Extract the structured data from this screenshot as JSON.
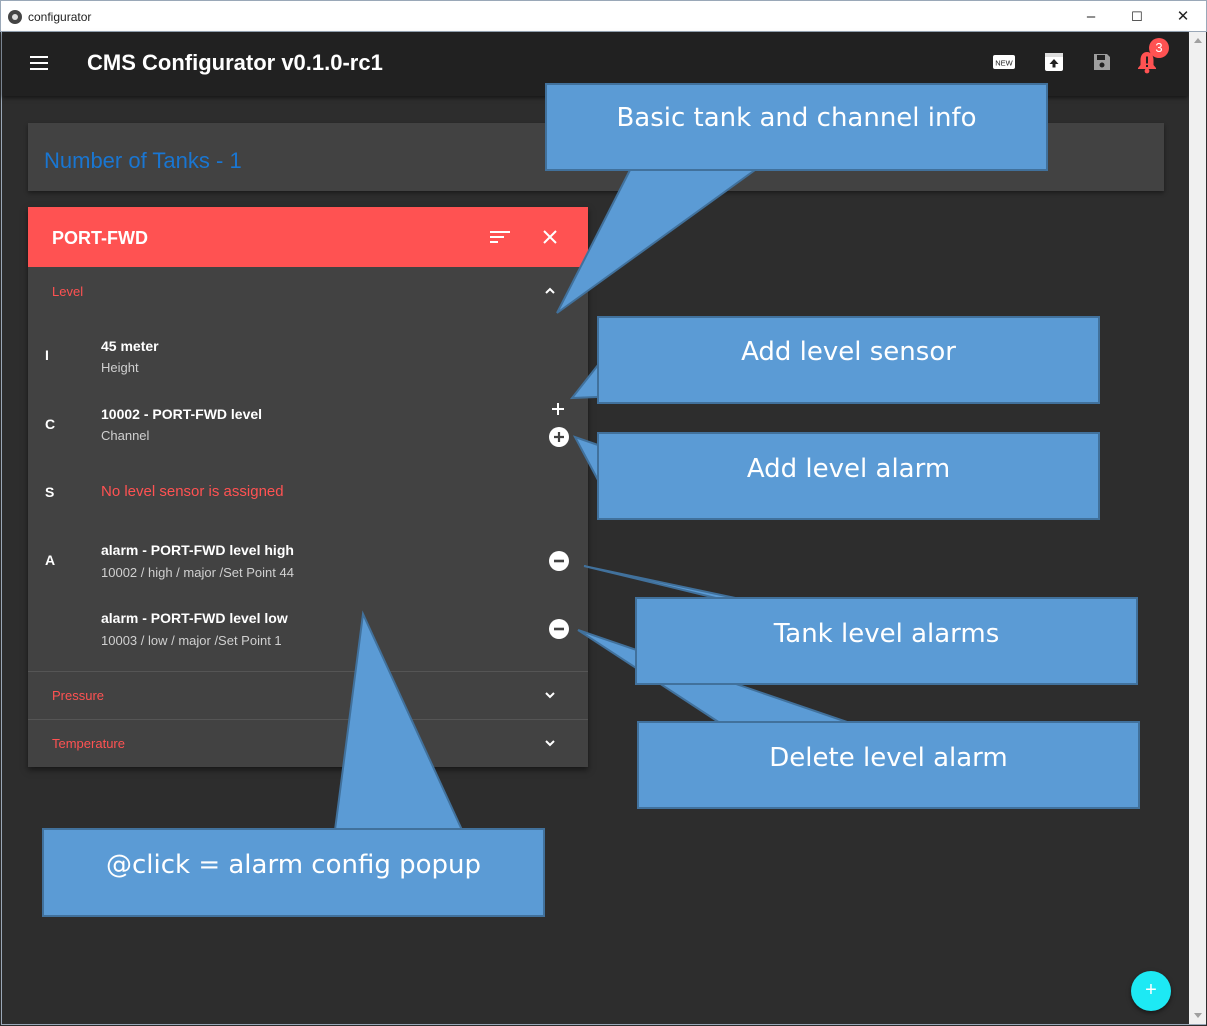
{
  "window": {
    "title": "configurator",
    "controls": [
      "–",
      "☐",
      "✕"
    ]
  },
  "appbar": {
    "title": "CMS Configurator v0.1.0-rc1",
    "new_icon_text": "NEW",
    "notification_count": "3"
  },
  "summary": {
    "text": "Number of Tanks - 1"
  },
  "tank": {
    "name": "PORT-FWD",
    "sections": {
      "level": "Level",
      "pressure": "Pressure",
      "temperature": "Temperature"
    },
    "rows": {
      "info": {
        "letter": "I",
        "title": "45 meter",
        "sub": "Height"
      },
      "channel": {
        "letter": "C",
        "title": "10002 - PORT-FWD level",
        "sub": "Channel"
      },
      "sensor": {
        "letter": "S",
        "text": "No level sensor is assigned"
      },
      "alarms": {
        "letter": "A",
        "items": [
          {
            "title": "alarm - PORT-FWD level high",
            "sub": "10002 / high / major /Set Point  44"
          },
          {
            "title": "alarm - PORT-FWD level low",
            "sub": "10003 / low / major /Set Point  1"
          }
        ]
      }
    }
  },
  "fab_label": "+",
  "callouts": {
    "basic_info": "Basic tank and channel info",
    "add_sensor": "Add level sensor",
    "add_alarm": "Add level alarm",
    "tank_alarms": "Tank level alarms",
    "delete_alarm": "Delete level alarm",
    "click_popup": "@click = alarm config popup"
  },
  "colors": {
    "accent_red": "#ff5252",
    "link_blue": "#1976d2",
    "fab_cyan": "#1de9f4",
    "callout_blue": "#5b9bd5"
  }
}
